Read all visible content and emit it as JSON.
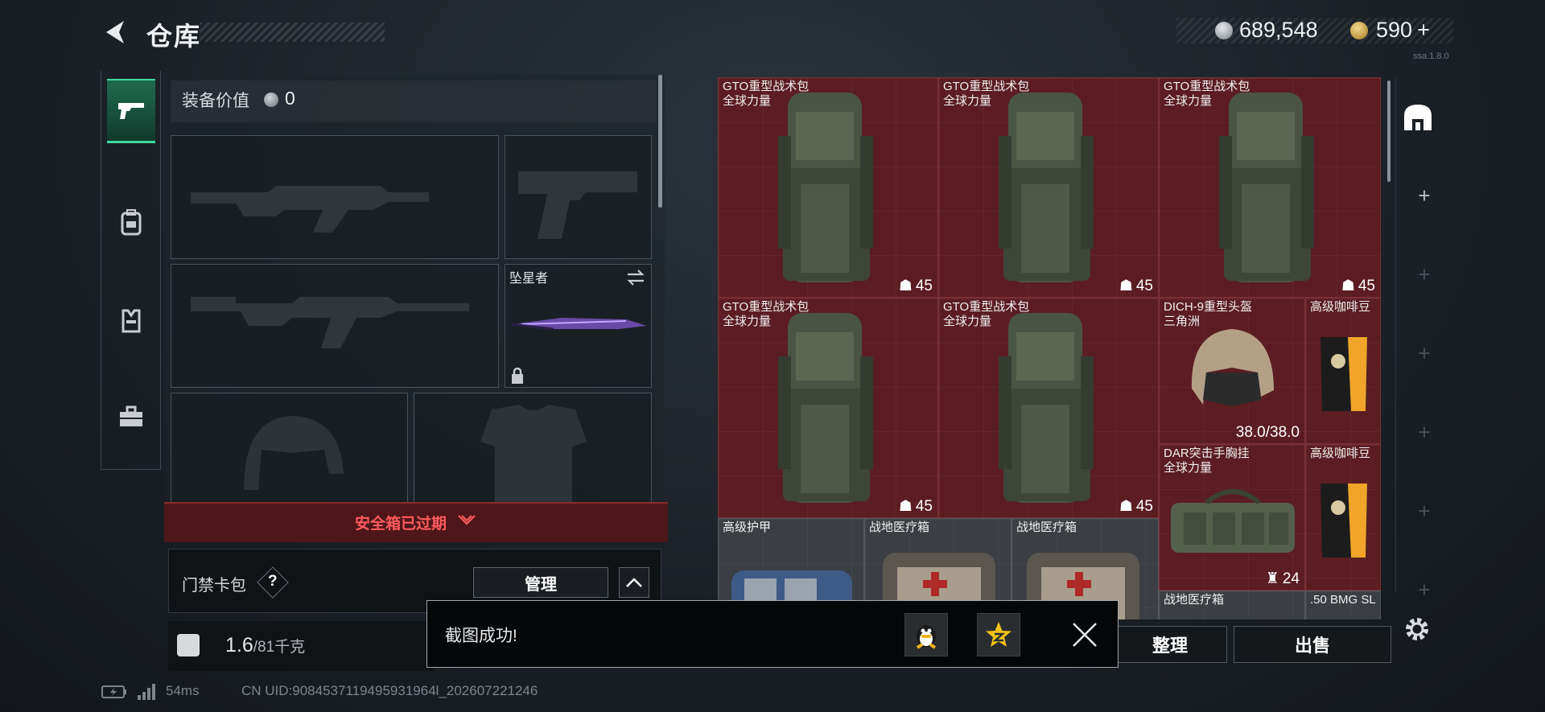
{
  "header": {
    "title": "仓库",
    "currency_silver": "689,548",
    "currency_gold": "590",
    "currency_gold_add": "+",
    "version": "ssa.1.8.0"
  },
  "nav": {
    "items": [
      {
        "icon": "pistol-icon",
        "active": true
      },
      {
        "icon": "backpack-icon",
        "active": false
      },
      {
        "icon": "vest-icon",
        "active": false
      },
      {
        "icon": "briefcase-icon",
        "active": false
      }
    ]
  },
  "loadout": {
    "equip_value_label": "装备价值",
    "equip_value": "0",
    "melee_name": "坠星者",
    "safe_box_status": "安全箱已过期",
    "access_card_label": "门禁卡包",
    "access_help": "?",
    "manage_label": "管理",
    "weight_current": "1.6",
    "weight_max": "/81千克"
  },
  "inventory": {
    "items": [
      {
        "name": "GTO重型战术包",
        "sub": "全球力量",
        "count": "45"
      },
      {
        "name": "GTO重型战术包",
        "sub": "全球力量",
        "count": "45"
      },
      {
        "name": "GTO重型战术包",
        "sub": "全球力量",
        "count": "45"
      },
      {
        "name": "GTO重型战术包",
        "sub": "全球力量",
        "count": "45"
      },
      {
        "name": "GTO重型战术包",
        "sub": "全球力量",
        "count": "45"
      },
      {
        "name": "DICH-9重型头盔",
        "sub": "三角洲",
        "count": "38.0/38.0"
      },
      {
        "name": "高级咖啡豆",
        "sub": "",
        "count": ""
      },
      {
        "name": "DAR突击手胸挂",
        "sub": "全球力量",
        "count": "24"
      },
      {
        "name": "高级咖啡豆",
        "sub": "",
        "count": ""
      },
      {
        "name": "高级护甲",
        "sub": "",
        "count": ""
      },
      {
        "name": "战地医疗箱",
        "sub": "",
        "count": ""
      },
      {
        "name": "战地医疗箱",
        "sub": "",
        "count": ""
      },
      {
        "name": "战地医疗箱",
        "sub": "",
        "count": ""
      },
      {
        "name": ".50 BMG SL",
        "sub": "",
        "count": ""
      }
    ],
    "sort_label": "整理",
    "sell_label": "出售"
  },
  "toast": {
    "message": "截图成功!",
    "share_qq_icon": "qq-penguin-icon",
    "share_qzone_icon": "qzone-star-icon"
  },
  "status_bar": {
    "ping": "54ms",
    "uid": "CN UID:9084537119495931964l_202607221246"
  },
  "colors": {
    "accent_green": "#42d79c",
    "item_red": "#5b1d22",
    "warning_red": "#ff5b5e"
  }
}
